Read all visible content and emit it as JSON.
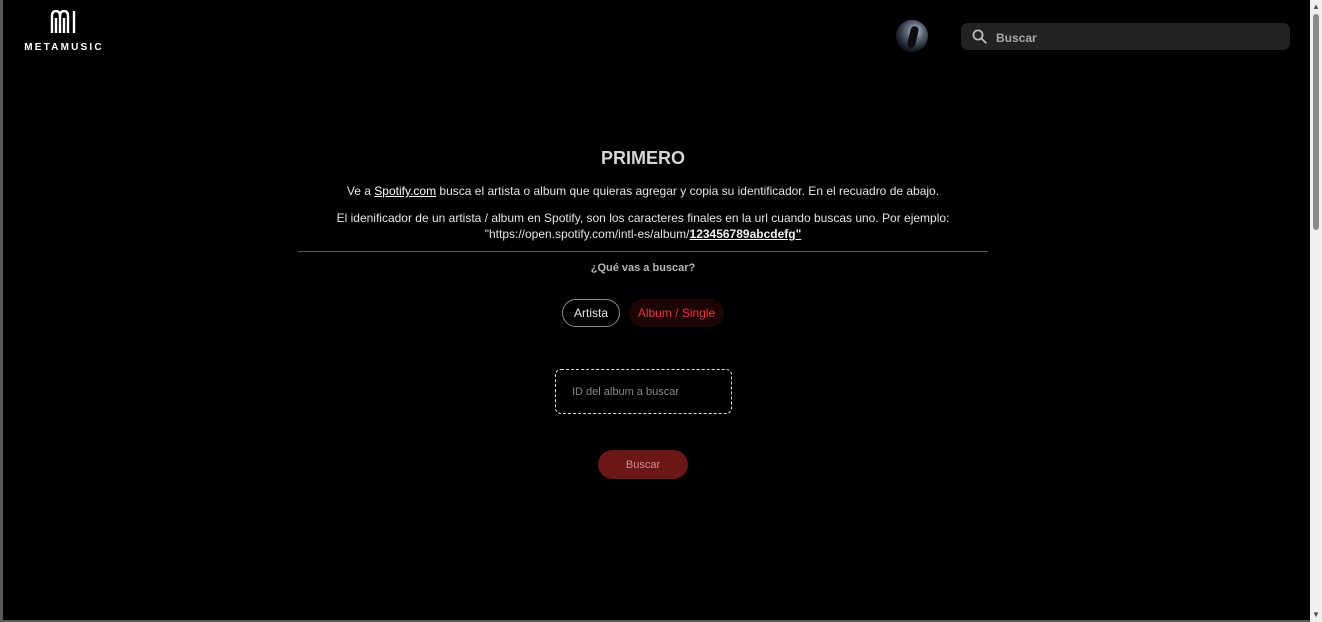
{
  "brand": {
    "name": "METAMUSIC",
    "icon": "metamusic-logo-icon"
  },
  "header": {
    "search": {
      "placeholder": "Buscar",
      "icon": "search-icon"
    },
    "avatar_icon": "user-avatar"
  },
  "main": {
    "title": "PRIMERO",
    "instruction": {
      "prefix": "Ve a ",
      "link": "Spotify.com",
      "suffix": " busca el artista o album que quieras agregar y copia su identificador. En el recuadro de abajo."
    },
    "example": {
      "line1": "El idenificador de un artista / album en Spotify, son los caracteres finales en la url cuando buscas uno. Por ejemplo:",
      "url_prefix": "\"https://open.spotify.com/intl-es/album/",
      "url_id": "123456789abcdefg\""
    },
    "question": "¿Qué vas a buscar?",
    "options": [
      {
        "label": "Artista",
        "selected": false
      },
      {
        "label": "Album / Single",
        "selected": true
      }
    ],
    "id_input": {
      "placeholder": "ID del album a buscar",
      "value": ""
    },
    "submit_label": "Buscar"
  },
  "colors": {
    "background": "#000000",
    "accent": "#e63535",
    "submit_bg": "#6b1717"
  }
}
